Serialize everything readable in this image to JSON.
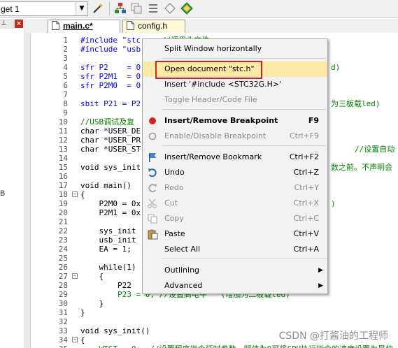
{
  "toolbar": {
    "target_value": "get 1",
    "icons": [
      "dropdown-arrow-icon",
      "magic-wand-icon",
      "settings-tree-icon",
      "copy-stack-icon",
      "manage-icon",
      "packs-icon"
    ]
  },
  "left_pane": {
    "pin_glyph": "⊥",
    "close_glyph": "×",
    "label": "B"
  },
  "tabs": [
    {
      "label": "main.c*",
      "active": true
    },
    {
      "label": "config.h",
      "active": false
    }
  ],
  "code_lines": [
    {
      "n": "1",
      "text": "#include \"stc"
    },
    {
      "n": "2",
      "text": "#include \"usb"
    },
    {
      "n": "3",
      "text": ""
    },
    {
      "n": "4",
      "text": "sfr P2    = 0"
    },
    {
      "n": "5",
      "text": "sfr P2M1  = 0"
    },
    {
      "n": "6",
      "text": "sfr P2M0  = 0"
    },
    {
      "n": "7",
      "text": ""
    },
    {
      "n": "8",
      "text": "sbit P21 = P2"
    },
    {
      "n": "9",
      "text": ""
    },
    {
      "n": "10",
      "text": "//USB调试及复"
    },
    {
      "n": "11",
      "text": "char *USER_DE"
    },
    {
      "n": "12",
      "text": "char *USER_PR"
    },
    {
      "n": "13",
      "text": "char *USER_ST"
    },
    {
      "n": "14",
      "text": ""
    },
    {
      "n": "15",
      "text": "void sys_init"
    },
    {
      "n": "16",
      "text": ""
    },
    {
      "n": "17",
      "text": "void main()"
    },
    {
      "n": "18",
      "text": "{"
    },
    {
      "n": "19",
      "text": "    P2M0 = 0x"
    },
    {
      "n": "20",
      "text": "    P2M1 = 0x"
    },
    {
      "n": "21",
      "text": ""
    },
    {
      "n": "22",
      "text": "    sys_init"
    },
    {
      "n": "23",
      "text": "    usb_init"
    },
    {
      "n": "24",
      "text": "    EA = 1;"
    },
    {
      "n": "25",
      "text": ""
    },
    {
      "n": "26",
      "text": "    while(1)"
    },
    {
      "n": "27",
      "text": "    {"
    },
    {
      "n": "28",
      "text": "        P22"
    },
    {
      "n": "29",
      "text": "        P23 = 0; //设置高电平   (增加为二板载led)"
    },
    {
      "n": "30",
      "text": "    }"
    },
    {
      "n": "31",
      "text": "}"
    },
    {
      "n": "32",
      "text": ""
    },
    {
      "n": "33",
      "text": "void sys_init()"
    },
    {
      "n": "34",
      "text": "{"
    },
    {
      "n": "35",
      "text": "    WTST = 0;  //设置程序指令延时参数，赋值为0可将CPU执行指令的速度设置为最快"
    }
  ],
  "code_right_fragments": {
    "r1": "//调用头文件",
    "r4": "d)",
    "r8": "为三板载led)",
    "r13": "//设置自动",
    "r15": "数之前。不声明会",
    "r19": ")"
  },
  "context_menu": {
    "items": [
      {
        "label": "Split Window horizontally",
        "shortcut": "",
        "icon": "",
        "disabled": false,
        "bold": false
      },
      {
        "label": "Open document \"stc.h\"",
        "shortcut": "",
        "icon": "",
        "disabled": false,
        "bold": false,
        "highlighted": true
      },
      {
        "label": "Insert '#include <STC32G.H>'",
        "shortcut": "",
        "icon": "",
        "disabled": false,
        "bold": false
      },
      {
        "label": "Toggle Header/Code File",
        "shortcut": "",
        "icon": "",
        "disabled": true,
        "bold": false
      },
      {
        "label": "Insert/Remove Breakpoint",
        "shortcut": "F9",
        "icon": "breakpoint-red-dot-icon",
        "disabled": false,
        "bold": true
      },
      {
        "label": "Enable/Disable Breakpoint",
        "shortcut": "Ctrl+F9",
        "icon": "breakpoint-hollow-circle-icon",
        "disabled": true,
        "bold": false
      },
      {
        "label": "Insert/Remove Bookmark",
        "shortcut": "Ctrl+F2",
        "icon": "bookmark-flag-icon",
        "disabled": false,
        "bold": false
      },
      {
        "label": "Undo",
        "shortcut": "Ctrl+Z",
        "icon": "undo-arrow-icon",
        "disabled": false,
        "bold": false
      },
      {
        "label": "Redo",
        "shortcut": "Ctrl+Y",
        "icon": "redo-arrow-icon",
        "disabled": true,
        "bold": false
      },
      {
        "label": "Cut",
        "shortcut": "Ctrl+X",
        "icon": "scissors-icon",
        "disabled": true,
        "bold": false
      },
      {
        "label": "Copy",
        "shortcut": "Ctrl+C",
        "icon": "copy-pages-icon",
        "disabled": true,
        "bold": false
      },
      {
        "label": "Paste",
        "shortcut": "Ctrl+V",
        "icon": "clipboard-paste-icon",
        "disabled": false,
        "bold": false
      },
      {
        "label": "Select All",
        "shortcut": "Ctrl+A",
        "icon": "",
        "disabled": false,
        "bold": false
      },
      {
        "label": "Outlining",
        "shortcut": "",
        "icon": "",
        "disabled": false,
        "bold": false,
        "submenu": true
      },
      {
        "label": "Advanced",
        "shortcut": "",
        "icon": "",
        "disabled": false,
        "bold": false,
        "submenu": true
      }
    ],
    "highlight_color": "#fde9a6",
    "callout_color": "#d8231c"
  },
  "watermark": "CSDN @打酱油的工程师"
}
